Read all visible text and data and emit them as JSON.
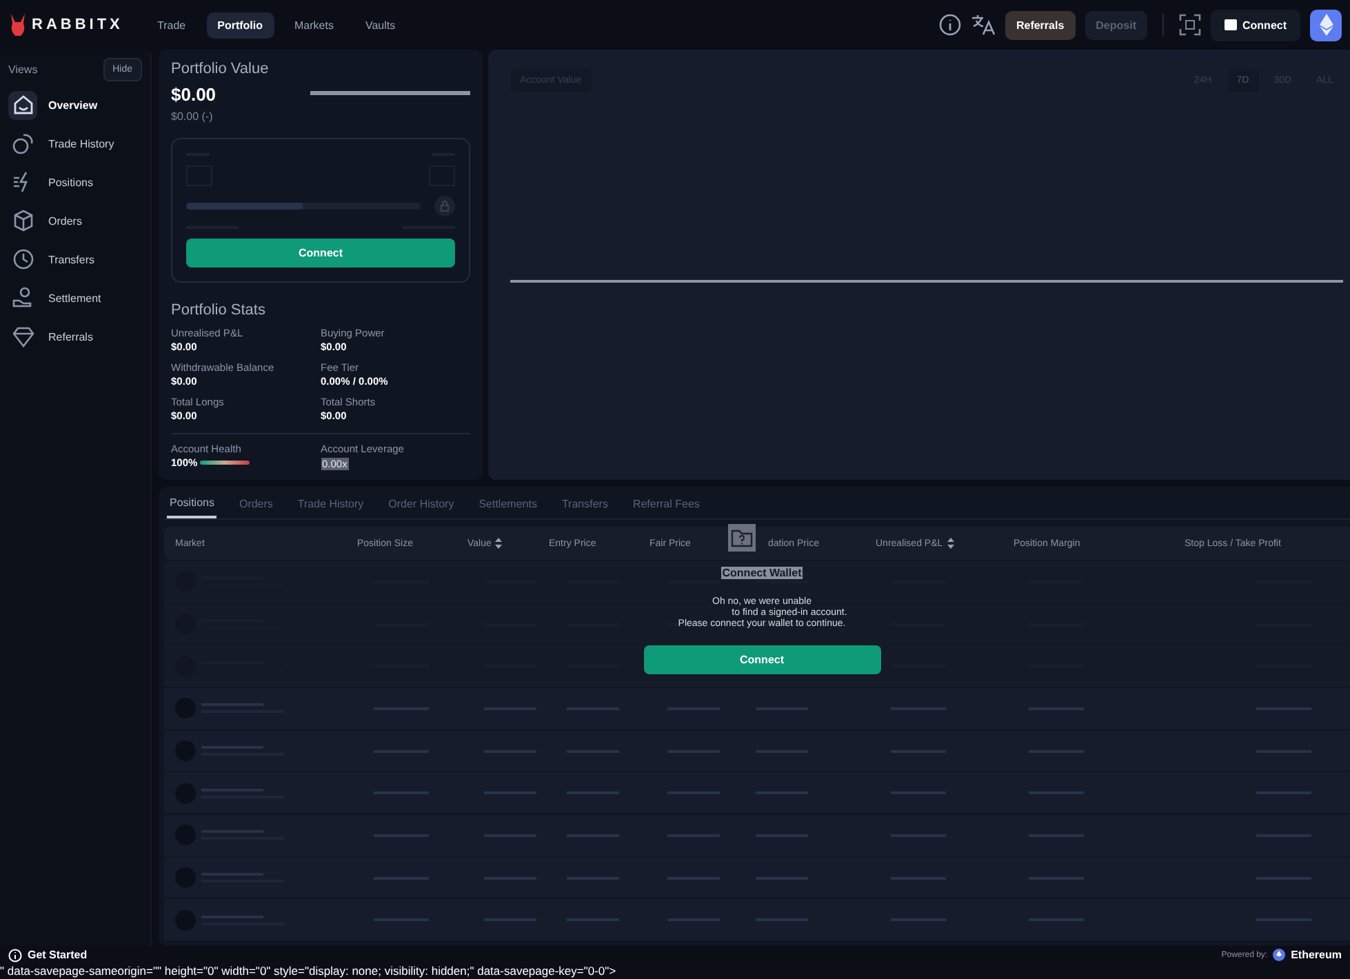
{
  "brand": "RABBITX",
  "nav": [
    {
      "label": "Trade",
      "selected": false
    },
    {
      "label": "Portfolio",
      "selected": true
    },
    {
      "label": "Markets",
      "selected": false
    },
    {
      "label": "Vaults",
      "selected": false
    }
  ],
  "header_buttons": {
    "referrals": "Referrals",
    "deposit": "Deposit",
    "connect": "Connect"
  },
  "sidebar": {
    "title": "Views",
    "hide": "Hide",
    "items": [
      {
        "label": "Overview",
        "selected": true
      },
      {
        "label": "Trade History",
        "selected": false
      },
      {
        "label": "Positions",
        "selected": false
      },
      {
        "label": "Orders",
        "selected": false
      },
      {
        "label": "Transfers",
        "selected": false
      },
      {
        "label": "Settlement",
        "selected": false
      },
      {
        "label": "Referrals",
        "selected": false
      }
    ]
  },
  "portfolio": {
    "title": "Portfolio Value",
    "value": "$0.00",
    "change": "$0.00 (-)",
    "connect": "Connect"
  },
  "stats": {
    "title": "Portfolio Stats",
    "items": [
      {
        "label": "Unrealised P&L",
        "value": "$0.00"
      },
      {
        "label": "Buying Power",
        "value": "$0.00"
      },
      {
        "label": "Withdrawable Balance",
        "value": "$0.00"
      },
      {
        "label": "Fee Tier",
        "value": "0.00% / 0.00%"
      },
      {
        "label": "Total Longs",
        "value": "$0.00"
      },
      {
        "label": "Total Shorts",
        "value": "$0.00"
      }
    ],
    "health_label": "Account Health",
    "health": "100%",
    "leverage_label": "Account Leverage",
    "leverage": "0.00x"
  },
  "chart": {
    "metric": "Account Value",
    "ranges": [
      {
        "label": "24H",
        "selected": false
      },
      {
        "label": "7D",
        "selected": true
      },
      {
        "label": "30D",
        "selected": false
      },
      {
        "label": "ALL",
        "selected": false
      }
    ]
  },
  "tabs": [
    {
      "label": "Positions",
      "selected": true
    },
    {
      "label": "Orders",
      "selected": false
    },
    {
      "label": "Trade History",
      "selected": false
    },
    {
      "label": "Order History",
      "selected": false
    },
    {
      "label": "Settlements",
      "selected": false
    },
    {
      "label": "Transfers",
      "selected": false
    },
    {
      "label": "Referral Fees",
      "selected": false
    }
  ],
  "table": {
    "columns": [
      {
        "label": "Market",
        "sortable": false
      },
      {
        "label": "Position Size",
        "sortable": false
      },
      {
        "label": "Value",
        "sortable": true
      },
      {
        "label": "Entry Price",
        "sortable": false
      },
      {
        "label": "Fair Price",
        "sortable": false
      },
      {
        "label": "dation Price",
        "sortable": false
      },
      {
        "label": "Unrealised P&L",
        "sortable": true
      },
      {
        "label": "Position Margin",
        "sortable": false
      },
      {
        "label": "Stop Loss / Take Profit",
        "sortable": false
      }
    ]
  },
  "empty": {
    "title": "Connect Wallet",
    "line1": "Oh no, we were unable",
    "line2": "to find a signed-in account.",
    "line3": "Please connect your wallet to continue.",
    "button": "Connect"
  },
  "footer": {
    "get_started": "Get Started",
    "powered": "Powered by:",
    "network": "Ethereum"
  },
  "stray_text": "\" data-savepage-sameorigin=\"\" height=\"0\" width=\"0\" style=\"display: none; visibility: hidden;\" data-savepage-key=\"0-0\">"
}
